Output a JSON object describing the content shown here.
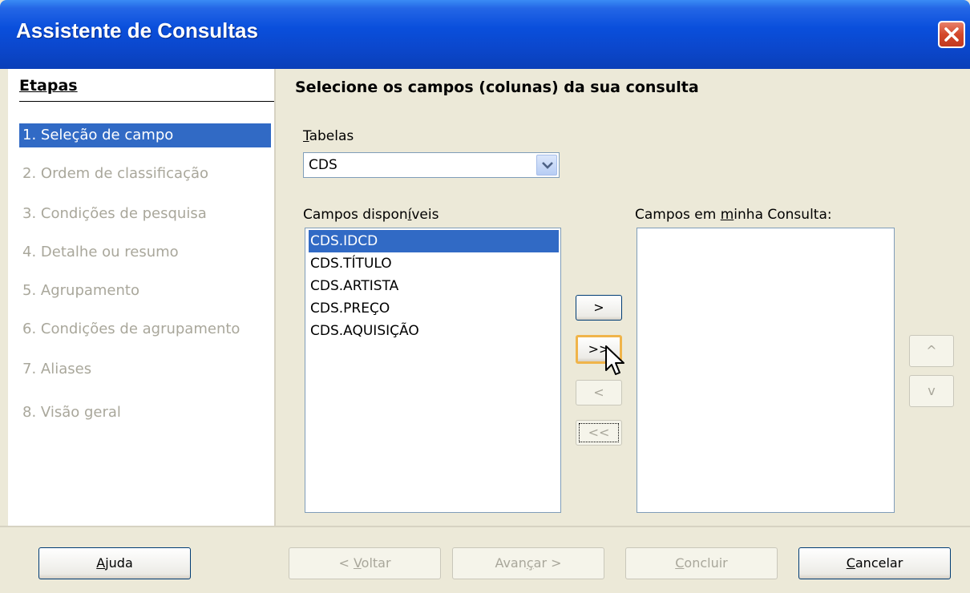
{
  "window": {
    "title": "Assistente de Consultas",
    "close_label": "close"
  },
  "sidebar": {
    "title": "Etapas",
    "steps": [
      "1. Seleção de campo",
      "2. Ordem de classificação",
      "3. Condições de pesquisa",
      "4. Detalhe ou resumo",
      "5. Agrupamento",
      "6. Condições de agrupamento",
      "7. Aliases",
      "8. Visão geral"
    ],
    "active_step": 0
  },
  "main": {
    "title": "Selecione os campos (colunas) da sua consulta",
    "tables_label_prefix": "T",
    "tables_label_rest": "abelas",
    "tables_value": "CDS",
    "available_label_a": "Campos dispon",
    "available_label_u": "í",
    "available_label_b": "veis",
    "available_fields": [
      "CDS.IDCD",
      "CDS.TÍTULO",
      "CDS.ARTISTA",
      "CDS.PREÇO",
      "CDS.AQUISIÇÃO"
    ],
    "selected_index": 0,
    "selected_label_a": "Campos em ",
    "selected_label_u": "m",
    "selected_label_b": "inha Consulta:",
    "selected_fields": []
  },
  "transfer": {
    "add_one": ">",
    "add_all": ">>",
    "remove_one": "<",
    "remove_all": "<<",
    "move_up": "^",
    "move_down": "v"
  },
  "footer": {
    "help_u": "A",
    "help_rest": "juda",
    "back_a": "< ",
    "back_u": "V",
    "back_b": "oltar",
    "next_a": "Avan",
    "next_u": "ç",
    "next_b": "ar >",
    "finish_u": "C",
    "finish_rest": "oncluir",
    "cancel_u": "C",
    "cancel_rest": "ancelar"
  },
  "colors": {
    "titlebar": "#0a4fdc",
    "selection": "#316ac5",
    "window_bg": "#ece9d8",
    "focus_ring": "#f0b44a"
  }
}
